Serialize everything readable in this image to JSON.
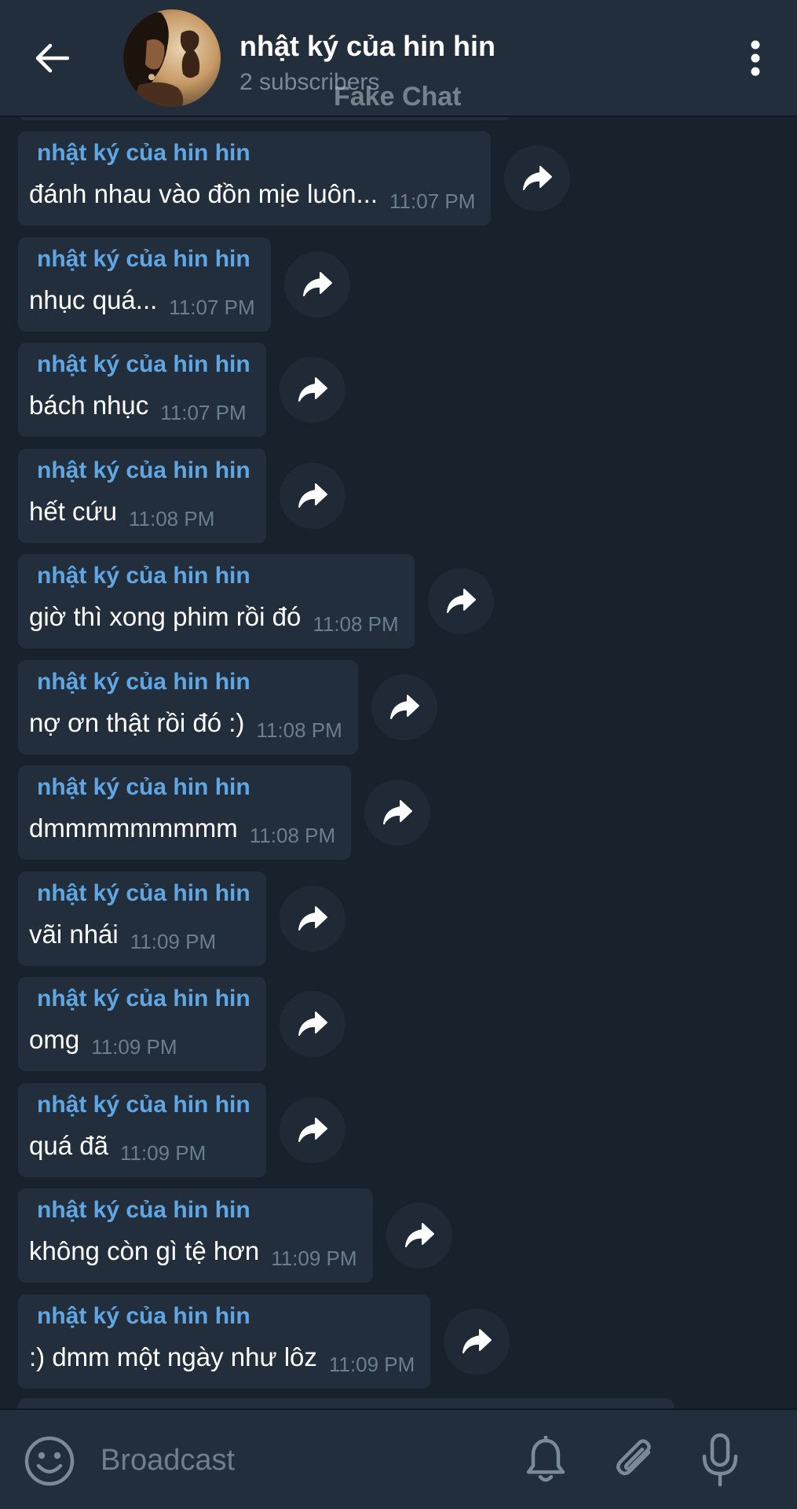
{
  "header": {
    "title": "nhật ký của hin hin",
    "subtitle": "2 subscribers",
    "watermark": "Fake Chat",
    "back_icon": "arrow-left-icon",
    "menu_icon": "more-vertical-icon"
  },
  "colors": {
    "background": "#18222d",
    "header": "#232e3c",
    "bubble": "#232e3c",
    "sender": "#5fa6e3",
    "time": "#6b7e8f"
  },
  "messages": [
    {
      "sender": "nhật ký của hin hin",
      "text": "đánh nhau vào đồn mịe luôn...",
      "time": "11:07 PM"
    },
    {
      "sender": "nhật ký của hin hin",
      "text": "nhục quá...",
      "time": "11:07 PM"
    },
    {
      "sender": "nhật ký của hin hin",
      "text": "bách nhục",
      "time": "11:07 PM"
    },
    {
      "sender": "nhật ký của hin hin",
      "text": "hết cứu",
      "time": "11:08 PM"
    },
    {
      "sender": "nhật ký của hin hin",
      "text": "giờ thì xong phim rồi đó",
      "time": "11:08 PM"
    },
    {
      "sender": "nhật ký của hin hin",
      "text": "nợ ơn thật rồi đó :)",
      "time": "11:08 PM"
    },
    {
      "sender": "nhật ký của hin hin",
      "text": "dmmmmmmmmm",
      "time": "11:08 PM"
    },
    {
      "sender": "nhật ký của hin hin",
      "text": "vãi nhái",
      "time": "11:09 PM"
    },
    {
      "sender": "nhật ký của hin hin",
      "text": "omg",
      "time": "11:09 PM"
    },
    {
      "sender": "nhật ký của hin hin",
      "text": "quá đã",
      "time": "11:09 PM"
    },
    {
      "sender": "nhật ký của hin hin",
      "text": "không còn gì tệ hơn",
      "time": "11:09 PM"
    },
    {
      "sender": "nhật ký của hin hin",
      "text": ":) dmm một ngày như lôz",
      "time": "11:09 PM"
    }
  ],
  "input_bar": {
    "placeholder": "Broadcast",
    "emoji_icon": "emoji-icon",
    "bell_icon": "bell-icon",
    "attach_icon": "paperclip-icon",
    "mic_icon": "microphone-icon"
  }
}
